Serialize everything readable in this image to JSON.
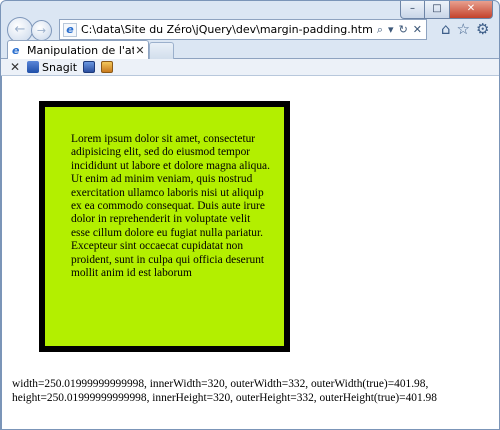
{
  "window": {
    "caption_buttons": {
      "minimize": "–",
      "maximize": "□",
      "close": "✕"
    }
  },
  "nav": {
    "back_glyph": "←",
    "forward_glyph": "→",
    "address": "C:\\data\\Site du Zéro\\jQuery\\dev\\margin-padding.htm",
    "addr_icons": {
      "search": "⌕",
      "dropdown": "▾",
      "refresh": "↻",
      "stop": "✕"
    },
    "favicon": "e",
    "right_icons": {
      "home": "⌂",
      "favorites": "☆",
      "tools": "⚙"
    }
  },
  "tab": {
    "title": "Manipulation de l'attribut c...",
    "close": "✕"
  },
  "toolbar": {
    "close": "✕",
    "snagit_label": "Snagit"
  },
  "page": {
    "box_color": "#b3ef00",
    "lorem": "Lorem ipsum dolor sit amet, consectetur adipisicing elit, sed do eiusmod tempor incididunt ut labore et dolore magna aliqua. Ut enim ad minim veniam, quis nostrud exercitation ullamco laboris nisi ut aliquip ex ea commodo consequat. Duis aute irure dolor in reprehenderit in voluptate velit esse cillum dolore eu fugiat nulla pariatur. Excepteur sint occaecat cupidatat non proident, sunt in culpa qui officia deserunt mollit anim id est laborum",
    "width_line": "width=250.01999999999998, innerWidth=320, outerWidth=332, outerWidth(true)=401.98,",
    "height_line": "height=250.01999999999998, innerHeight=320, outerHeight=332, outerHeight(true)=401.98"
  }
}
